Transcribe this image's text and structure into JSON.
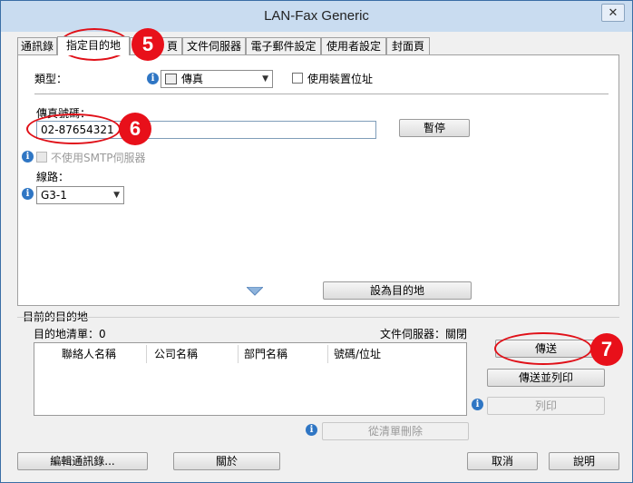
{
  "window": {
    "title": "LAN-Fax Generic",
    "close_glyph": "✕"
  },
  "tabs": [
    {
      "label": "通訊錄"
    },
    {
      "label": "指定目的地"
    },
    {
      "label": "頁"
    },
    {
      "label": "文件伺服器"
    },
    {
      "label": "電子郵件設定"
    },
    {
      "label": "使用者設定"
    },
    {
      "label": "封面頁"
    }
  ],
  "destination": {
    "type_label": "類型：",
    "type_value": "傳真",
    "device_address_label": "使用裝置位址",
    "fax_number_label": "傳真號碼：",
    "fax_number_value": "02-87654321",
    "pause_button": "暫停",
    "no_smtp_label": "不使用SMTP伺服器",
    "line_label": "線路：",
    "line_value": "G3-1",
    "set_destination_button": "設為目的地"
  },
  "current": {
    "group_title": "目前的目的地",
    "list_label": "目的地清單：0",
    "doc_server_status": "文件伺服器：關閉",
    "columns": [
      "聯絡人名稱",
      "公司名稱",
      "部門名稱",
      "號碼/位址"
    ],
    "remove_button": "從清單刪除"
  },
  "actions": {
    "send_button": "傳送",
    "send_print_button": "傳送並列印",
    "print_button": "列印"
  },
  "footer": {
    "edit_address_book_button": "編輯通訊錄...",
    "about_button": "關於",
    "cancel_button": "取消",
    "help_button": "說明"
  },
  "annotations": {
    "step5": "5",
    "step6": "6",
    "step7": "7"
  },
  "icons": [
    "info-icon",
    "fax-icon",
    "chevron-down-icon",
    "triangle-down-icon",
    "close-icon"
  ],
  "colors": {
    "title_bar": "#c9dcf0",
    "callout_red": "#e8101a",
    "info_blue": "#2f76c4"
  }
}
